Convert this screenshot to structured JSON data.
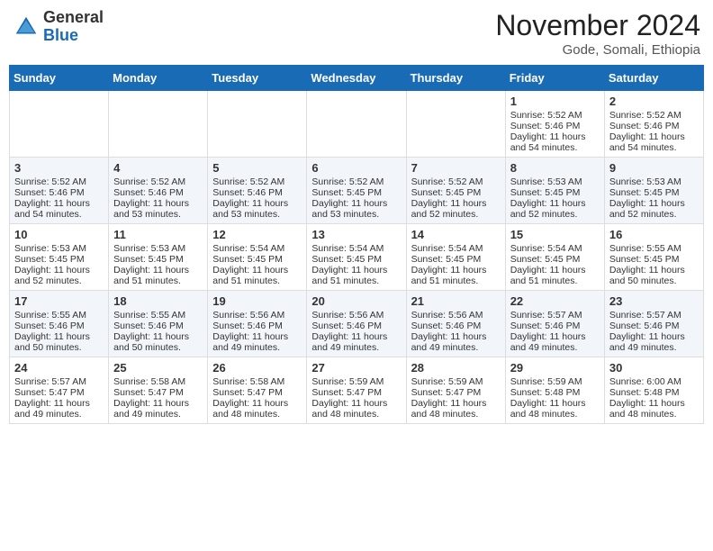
{
  "header": {
    "logo_general": "General",
    "logo_blue": "Blue",
    "month_title": "November 2024",
    "location": "Gode, Somali, Ethiopia"
  },
  "calendar": {
    "days_of_week": [
      "Sunday",
      "Monday",
      "Tuesday",
      "Wednesday",
      "Thursday",
      "Friday",
      "Saturday"
    ],
    "weeks": [
      [
        {
          "day": "",
          "data": ""
        },
        {
          "day": "",
          "data": ""
        },
        {
          "day": "",
          "data": ""
        },
        {
          "day": "",
          "data": ""
        },
        {
          "day": "",
          "data": ""
        },
        {
          "day": "1",
          "data": "Sunrise: 5:52 AM\nSunset: 5:46 PM\nDaylight: 11 hours and 54 minutes."
        },
        {
          "day": "2",
          "data": "Sunrise: 5:52 AM\nSunset: 5:46 PM\nDaylight: 11 hours and 54 minutes."
        }
      ],
      [
        {
          "day": "3",
          "data": "Sunrise: 5:52 AM\nSunset: 5:46 PM\nDaylight: 11 hours and 54 minutes."
        },
        {
          "day": "4",
          "data": "Sunrise: 5:52 AM\nSunset: 5:46 PM\nDaylight: 11 hours and 53 minutes."
        },
        {
          "day": "5",
          "data": "Sunrise: 5:52 AM\nSunset: 5:46 PM\nDaylight: 11 hours and 53 minutes."
        },
        {
          "day": "6",
          "data": "Sunrise: 5:52 AM\nSunset: 5:45 PM\nDaylight: 11 hours and 53 minutes."
        },
        {
          "day": "7",
          "data": "Sunrise: 5:52 AM\nSunset: 5:45 PM\nDaylight: 11 hours and 52 minutes."
        },
        {
          "day": "8",
          "data": "Sunrise: 5:53 AM\nSunset: 5:45 PM\nDaylight: 11 hours and 52 minutes."
        },
        {
          "day": "9",
          "data": "Sunrise: 5:53 AM\nSunset: 5:45 PM\nDaylight: 11 hours and 52 minutes."
        }
      ],
      [
        {
          "day": "10",
          "data": "Sunrise: 5:53 AM\nSunset: 5:45 PM\nDaylight: 11 hours and 52 minutes."
        },
        {
          "day": "11",
          "data": "Sunrise: 5:53 AM\nSunset: 5:45 PM\nDaylight: 11 hours and 51 minutes."
        },
        {
          "day": "12",
          "data": "Sunrise: 5:54 AM\nSunset: 5:45 PM\nDaylight: 11 hours and 51 minutes."
        },
        {
          "day": "13",
          "data": "Sunrise: 5:54 AM\nSunset: 5:45 PM\nDaylight: 11 hours and 51 minutes."
        },
        {
          "day": "14",
          "data": "Sunrise: 5:54 AM\nSunset: 5:45 PM\nDaylight: 11 hours and 51 minutes."
        },
        {
          "day": "15",
          "data": "Sunrise: 5:54 AM\nSunset: 5:45 PM\nDaylight: 11 hours and 51 minutes."
        },
        {
          "day": "16",
          "data": "Sunrise: 5:55 AM\nSunset: 5:45 PM\nDaylight: 11 hours and 50 minutes."
        }
      ],
      [
        {
          "day": "17",
          "data": "Sunrise: 5:55 AM\nSunset: 5:46 PM\nDaylight: 11 hours and 50 minutes."
        },
        {
          "day": "18",
          "data": "Sunrise: 5:55 AM\nSunset: 5:46 PM\nDaylight: 11 hours and 50 minutes."
        },
        {
          "day": "19",
          "data": "Sunrise: 5:56 AM\nSunset: 5:46 PM\nDaylight: 11 hours and 49 minutes."
        },
        {
          "day": "20",
          "data": "Sunrise: 5:56 AM\nSunset: 5:46 PM\nDaylight: 11 hours and 49 minutes."
        },
        {
          "day": "21",
          "data": "Sunrise: 5:56 AM\nSunset: 5:46 PM\nDaylight: 11 hours and 49 minutes."
        },
        {
          "day": "22",
          "data": "Sunrise: 5:57 AM\nSunset: 5:46 PM\nDaylight: 11 hours and 49 minutes."
        },
        {
          "day": "23",
          "data": "Sunrise: 5:57 AM\nSunset: 5:46 PM\nDaylight: 11 hours and 49 minutes."
        }
      ],
      [
        {
          "day": "24",
          "data": "Sunrise: 5:57 AM\nSunset: 5:47 PM\nDaylight: 11 hours and 49 minutes."
        },
        {
          "day": "25",
          "data": "Sunrise: 5:58 AM\nSunset: 5:47 PM\nDaylight: 11 hours and 49 minutes."
        },
        {
          "day": "26",
          "data": "Sunrise: 5:58 AM\nSunset: 5:47 PM\nDaylight: 11 hours and 48 minutes."
        },
        {
          "day": "27",
          "data": "Sunrise: 5:59 AM\nSunset: 5:47 PM\nDaylight: 11 hours and 48 minutes."
        },
        {
          "day": "28",
          "data": "Sunrise: 5:59 AM\nSunset: 5:47 PM\nDaylight: 11 hours and 48 minutes."
        },
        {
          "day": "29",
          "data": "Sunrise: 5:59 AM\nSunset: 5:48 PM\nDaylight: 11 hours and 48 minutes."
        },
        {
          "day": "30",
          "data": "Sunrise: 6:00 AM\nSunset: 5:48 PM\nDaylight: 11 hours and 48 minutes."
        }
      ]
    ]
  }
}
